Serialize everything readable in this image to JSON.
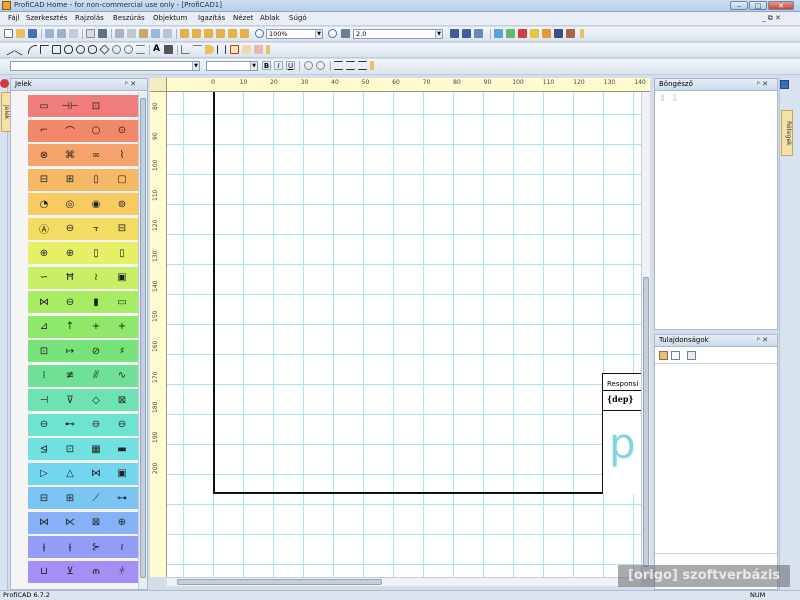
{
  "window": {
    "title": "ProfiCAD Home - for non-commercial use only - [ProfiCAD1]",
    "buttons": {
      "minimize": "–",
      "maximize": "□",
      "close": "✕"
    }
  },
  "menu": {
    "items": [
      "Fájl",
      "Szerkesztés",
      "Rajzolás",
      "Beszúrás",
      "Objektum",
      "Igazítás",
      "Nézet",
      "Ablak",
      "Súgó"
    ],
    "mdi_controls": "_ ⧉ ✕"
  },
  "toolbar": {
    "zoom_value": "100%",
    "line_width_value": "2.0",
    "font_bold": "B",
    "font_italic": "I",
    "font_underline": "U",
    "text_tool": "A"
  },
  "left_panel": {
    "title": "Jelek",
    "pin": "ᵖ ✕",
    "side_tab": "Jelek",
    "row_colors": [
      "#f07c7c",
      "#f2876a",
      "#f4a46a",
      "#f5b865",
      "#f6cb62",
      "#f3dc62",
      "#e6ef66",
      "#c9ef66",
      "#a8ec66",
      "#8ee86a",
      "#78e27a",
      "#70e096",
      "#6ee2b2",
      "#6ee3cd",
      "#72e0e0",
      "#74d5ee",
      "#7cc4f3",
      "#86b1f6",
      "#939cf6",
      "#a38ff5",
      "#b689f3",
      "#c88af2"
    ],
    "symbol_glyphs": [
      [
        "▭",
        "⊣⊢",
        "⊡"
      ],
      [
        "⌐",
        "⌒",
        "○",
        "⊙"
      ],
      [
        "⊗",
        "⌘",
        "∞",
        "⌇"
      ],
      [
        "⊟",
        "⊞",
        "▯",
        "▢"
      ],
      [
        "◔",
        "◎",
        "◉",
        "⊚"
      ],
      [
        "Ⓐ",
        "⊖",
        "⫟",
        "⊟"
      ],
      [
        "⊕",
        "⊕",
        "▯",
        "▯"
      ],
      [
        "∽",
        "Ħ",
        "≀",
        "▣"
      ],
      [
        "⋈",
        "⊖",
        "▮",
        "▭"
      ],
      [
        "⊿",
        "↑",
        "+",
        "+"
      ],
      [
        "⊡",
        "↦",
        "⊘",
        "♯"
      ],
      [
        "⁞",
        "≢",
        "⫻",
        "∿"
      ],
      [
        "⊣",
        "⊽",
        "◇",
        "⊠"
      ],
      [
        "⊖",
        "⊷",
        "⊖",
        "⊖"
      ],
      [
        "⊴",
        "⊡",
        "▦",
        "▬"
      ],
      [
        "▷",
        "△",
        "⋈",
        "▣"
      ],
      [
        "⊟",
        "⊞",
        "⟋",
        "⊶"
      ],
      [
        "⋈",
        "⋉",
        "⊠",
        "⊕"
      ],
      [
        "⫲",
        "⫲",
        "⊱",
        "≀"
      ],
      [
        "⊔",
        "⊻",
        "⫙",
        "⫩"
      ]
    ]
  },
  "rulers": {
    "top_labels": [
      "0",
      "10",
      "20",
      "30",
      "40",
      "50",
      "60",
      "70",
      "80",
      "90",
      "100",
      "110",
      "120",
      "130",
      "140"
    ],
    "left_labels": [
      "80",
      "90",
      "100",
      "110",
      "120",
      "130",
      "140",
      "150",
      "160",
      "170",
      "180",
      "190",
      "200"
    ]
  },
  "canvas": {
    "title_block_responsible": "Responsi",
    "title_block_dep": "{dep}",
    "title_block_big": "p"
  },
  "browser_panel": {
    "title": "Böngésző",
    "pin": "ᵖ ✕"
  },
  "props_panel": {
    "title": "Tulajdonságok",
    "pin": "ᵖ ✕"
  },
  "right_side_tab": "Rétegek",
  "status": {
    "version": "ProfiCAD 6.7.2",
    "num": "NUM"
  },
  "watermark": "[origo] szoftverbázis"
}
